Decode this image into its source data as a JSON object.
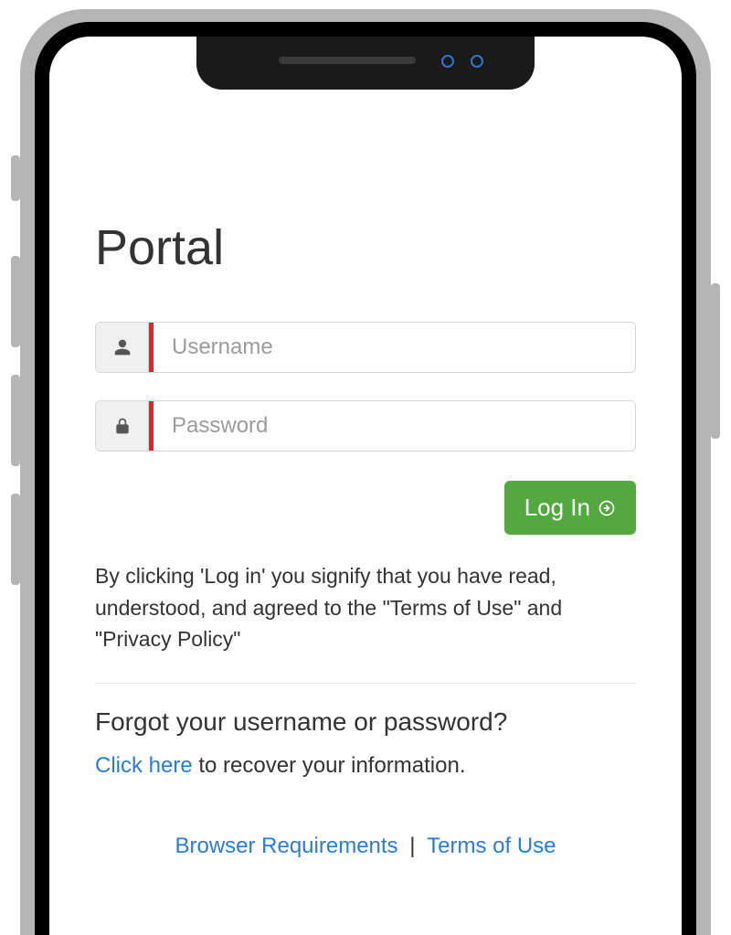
{
  "title": "Portal",
  "username": {
    "placeholder": "Username",
    "value": ""
  },
  "password": {
    "placeholder": "Password",
    "value": ""
  },
  "login_button": "Log In",
  "disclaimer": "By clicking 'Log in' you signify that you have read, understood, and agreed to the \"Terms of Use\" and \"Privacy Policy\"",
  "forgot": {
    "heading": "Forgot your username or password?",
    "link_text": "Click here",
    "rest_text": " to recover your information."
  },
  "footer": {
    "browser_req": "Browser Requirements",
    "terms": "Terms of Use",
    "separator": " | "
  }
}
